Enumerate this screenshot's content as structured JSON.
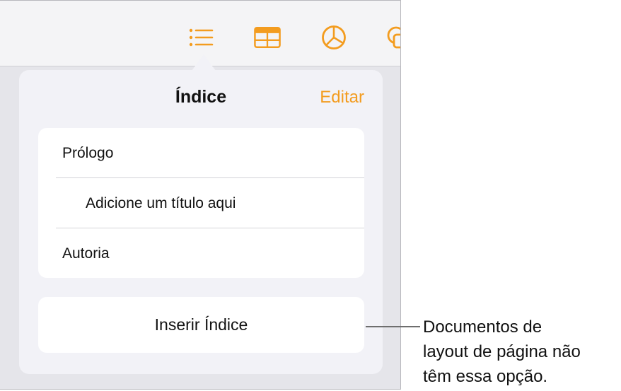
{
  "toolbar": {
    "buttons": [
      {
        "name": "list-icon"
      },
      {
        "name": "table-icon"
      },
      {
        "name": "chart-icon"
      },
      {
        "name": "shape-icon"
      }
    ],
    "accent_color": "#f39c1f"
  },
  "popover": {
    "title": "Índice",
    "edit_label": "Editar",
    "entries": [
      {
        "label": "Prólogo",
        "indent": 0
      },
      {
        "label": "Adicione um título aqui",
        "indent": 1
      },
      {
        "label": "Autoria",
        "indent": 0
      }
    ],
    "insert_label": "Inserir Índice"
  },
  "callout": {
    "lines": [
      "Documentos de",
      "layout de página não",
      "têm essa opção."
    ]
  }
}
